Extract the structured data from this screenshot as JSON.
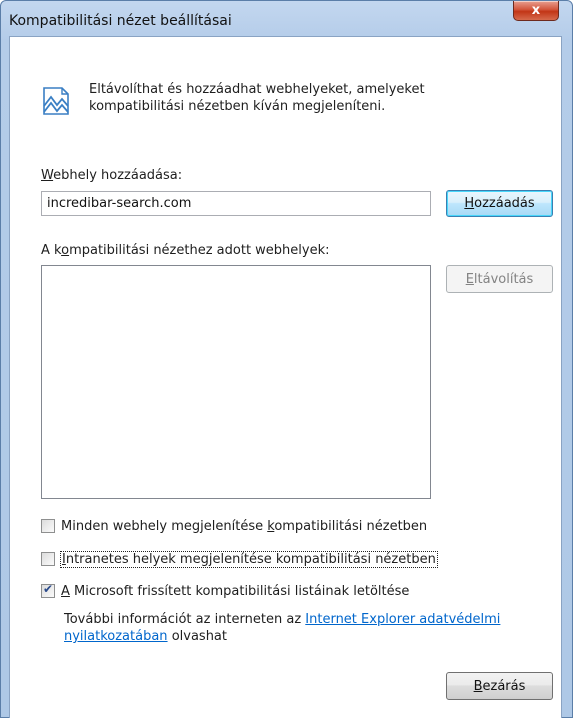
{
  "window": {
    "title": "Kompatibilitási nézet beállításai",
    "close_symbol": "x"
  },
  "intro": {
    "icon": "compatibility-view-icon",
    "text": "Eltávolíthat és hozzáadhat webhelyeket, amelyeket kompatibilitási nézetben kíván megjeleníteni."
  },
  "add_site": {
    "label_key": "W",
    "label_rest": "ebhely hozzáadása:",
    "input_value": "incredibar-search.com",
    "button_key": "H",
    "button_rest": "ozzáadás"
  },
  "site_list": {
    "label_start": "A k",
    "label_key": "o",
    "label_rest": "mpatibilitási nézethez adott webhelyek:",
    "items": [],
    "remove_key": "E",
    "remove_rest": "ltávolítás"
  },
  "options": [
    {
      "pre": "Minden webhely megjelenítése ",
      "key": "k",
      "post": "ompatibilitási nézetben",
      "checked": false
    },
    {
      "pre": "",
      "key": "I",
      "post": "ntranetes helyek megjelenítése kompatibilitási nézetben",
      "checked": false
    },
    {
      "pre": "",
      "key": "A",
      "post": " Microsoft frissített kompatibilitási listáinak letöltése",
      "checked": true
    }
  ],
  "more_info": {
    "before": "További információt az interneten az ",
    "link": "Internet Explorer adatvédelmi nyilatkozatában",
    "after": " olvashat"
  },
  "footer": {
    "close_key": "B",
    "close_rest": "ezárás"
  },
  "colors": {
    "link": "#0066cc",
    "titlebar": "#b4cce9",
    "close_button": "#c23516"
  }
}
